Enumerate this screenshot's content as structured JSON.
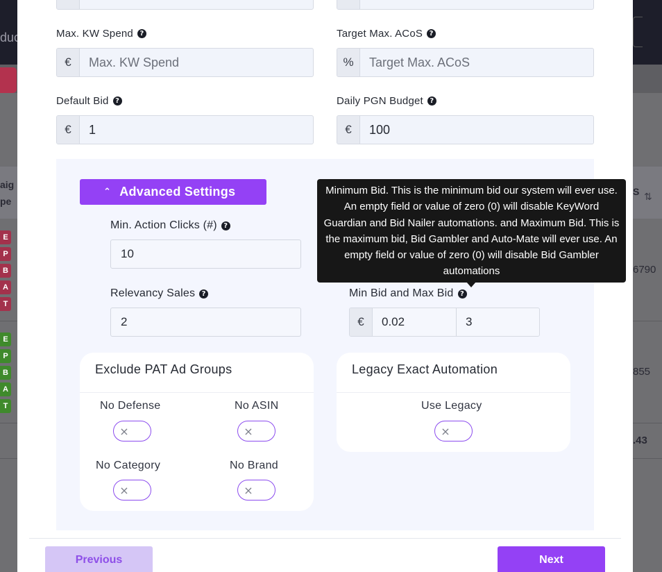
{
  "background": {
    "topbar_text": "duc",
    "header_left_lines": [
      "aig",
      "pe"
    ],
    "header_right": "S",
    "header_sort_icon": "sort-arrows-icon",
    "tags_row1": [
      "E",
      "P",
      "B",
      "A",
      "T"
    ],
    "tags_row2": [
      "E",
      "P",
      "B",
      "A",
      "T"
    ],
    "row_values": [
      "6790",
      "855",
      ".43"
    ]
  },
  "form": {
    "max_kw_spend": {
      "label": "Max. KW Spend",
      "addon": "€",
      "placeholder": "Max. KW Spend",
      "value": ""
    },
    "target_max_acos": {
      "label": "Target Max. ACoS",
      "addon": "%",
      "placeholder": "Target Max. ACoS",
      "value": ""
    },
    "default_bid": {
      "label": "Default Bid",
      "addon": "€",
      "value": "1"
    },
    "daily_pgn_budget": {
      "label": "Daily PGN Budget",
      "addon": "€",
      "value": "100"
    }
  },
  "advanced": {
    "button_label": "Advanced Settings",
    "min_action_clicks": {
      "label": "Min. Action Clicks (#)",
      "value": "10"
    },
    "relevancy_sales": {
      "label": "Relevancy Sales",
      "value": "2"
    },
    "min_max_bid": {
      "label": "Min Bid and Max Bid",
      "addon": "€",
      "min_value": "0.02",
      "max_value": "3"
    },
    "tooltip": "Minimum Bid. This is the minimum bid our system will ever use. An empty field or value of zero (0) will disable KeyWord Guardian and Bid Nailer automations. and Maximum Bid. This is the maximum bid, Bid Gambler and Auto-Mate will ever use. An empty field or value of zero (0) will disable Bid Gambler automations"
  },
  "exclude_pat": {
    "title": "Exclude PAT Ad Groups",
    "options": [
      {
        "label": "No Defense",
        "enabled": false
      },
      {
        "label": "No ASIN",
        "enabled": false
      },
      {
        "label": "No Category",
        "enabled": false
      },
      {
        "label": "No Brand",
        "enabled": false
      }
    ]
  },
  "legacy": {
    "title": "Legacy Exact Automation",
    "options": [
      {
        "label": "Use Legacy",
        "enabled": false
      }
    ]
  },
  "footer": {
    "previous": "Previous",
    "next": "Next"
  },
  "colors": {
    "accent": "#9441f5",
    "accent_light": "#d5c6f6",
    "tooltip_bg": "#171717"
  }
}
